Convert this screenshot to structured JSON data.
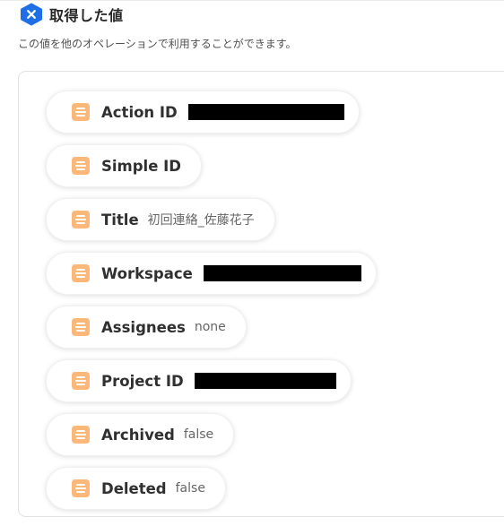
{
  "header": {
    "title": "取得した値",
    "subtitle": "この値を他のオペレーションで利用することができます。",
    "brand_color": "#1e6fe6"
  },
  "values": [
    {
      "label": "Action ID",
      "value": "",
      "redacted": true
    },
    {
      "label": "Simple ID",
      "value": "",
      "redacted": false
    },
    {
      "label": "Title",
      "value": "初回連絡_佐藤花子",
      "redacted": false
    },
    {
      "label": "Workspace",
      "value": "",
      "redacted": true
    },
    {
      "label": "Assignees",
      "value": "none",
      "redacted": false
    },
    {
      "label": "Project ID",
      "value": "",
      "redacted": true
    },
    {
      "label": "Archived",
      "value": "false",
      "redacted": false
    },
    {
      "label": "Deleted",
      "value": "false",
      "redacted": false
    }
  ],
  "colors": {
    "item_icon": "#fbb878",
    "redaction": "#000000"
  }
}
